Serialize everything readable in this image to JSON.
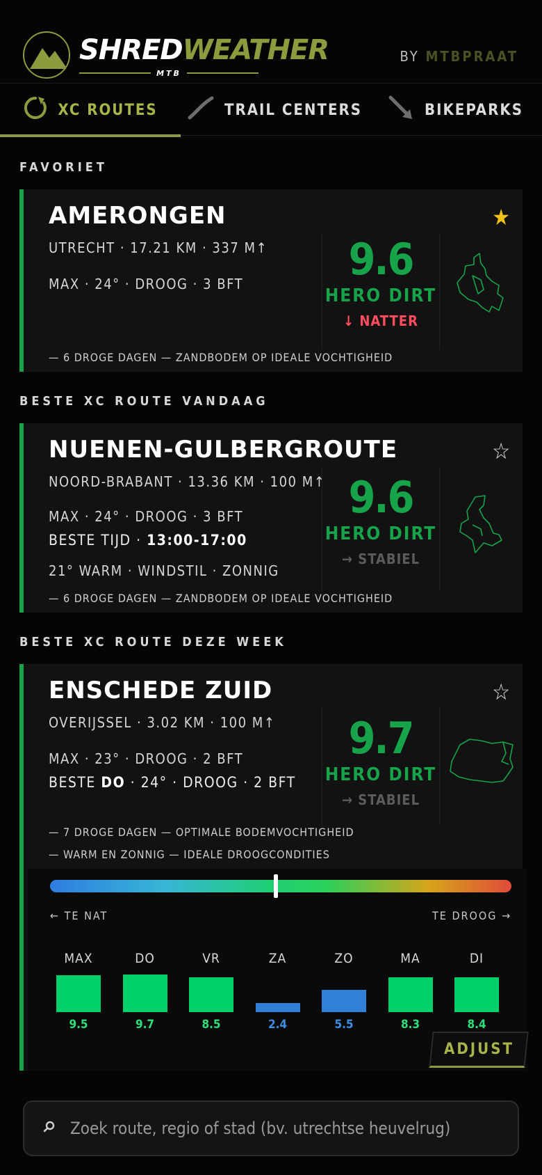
{
  "app": {
    "logo_part1": "SHRED",
    "logo_part2": "WEATHER",
    "logo_sub": "MTB",
    "by_label": "BY",
    "by_brand": "MTBPRAAT"
  },
  "tabs": [
    {
      "label": "XC ROUTES",
      "icon": "loop-icon",
      "active": true
    },
    {
      "label": "TRAIL CENTERS",
      "icon": "trail-icon",
      "active": false
    },
    {
      "label": "BIKEPARKS",
      "icon": "downhill-icon",
      "active": false
    }
  ],
  "sections": {
    "favorite": "FAVORIET",
    "best_today": "BESTE XC ROUTE VANDAAG",
    "best_week": "BESTE XC ROUTE DEZE WEEK"
  },
  "cards": {
    "amerongen": {
      "name": "AMERONGEN",
      "meta": "UTRECHT · 17.21 KM · 337 M↑",
      "weather": "MAX · 24° · DROOG · 3 BFT",
      "score": "9.6",
      "score_label": "HERO DIRT",
      "trend": "↓ NATTER",
      "notes": [
        "— 6 DROGE DAGEN — ZANDBODEM OP IDEALE VOCHTIGHEID"
      ],
      "favorite": true
    },
    "nuenen": {
      "name": "NUENEN-GULBERGROUTE",
      "meta": "NOORD-BRABANT · 13.36 KM · 100 M↑",
      "weather": "MAX · 24° · DROOG · 3 BFT",
      "best_time_label": "BESTE TIJD ·",
      "best_time_value": "13:00-17:00",
      "conditions": "21° WARM · WINDSTIL · ZONNIG",
      "score": "9.6",
      "score_label": "HERO DIRT",
      "trend": "→ STABIEL",
      "notes": [
        "— 6 DROGE DAGEN — ZANDBODEM OP IDEALE VOCHTIGHEID"
      ],
      "favorite": false
    },
    "enschede": {
      "name": "ENSCHEDE ZUID",
      "meta": "OVERIJSSEL · 3.02 KM · 100 M↑",
      "weather": "MAX · 23° · DROOG · 2 BFT",
      "best_prefix": "BESTE",
      "best_day": "DO",
      "best_suffix": "· 24° · DROOG · 2 BFT",
      "score": "9.7",
      "score_label": "HERO DIRT",
      "trend": "→ STABIEL",
      "notes": [
        "— 7 DROGE DAGEN — OPTIMALE BODEMVOCHTIGHEID",
        "— WARM EN ZONNIG — IDEALE DROOGCONDITIES"
      ],
      "favorite": false,
      "moisture_scale": {
        "left_label": "← TE NAT",
        "right_label": "TE DROOG →",
        "marker_position": 0.49
      },
      "forecast": [
        {
          "day": "MAX",
          "value": "9.5",
          "color": "#00d06a"
        },
        {
          "day": "DO",
          "value": "9.7",
          "color": "#00d06a"
        },
        {
          "day": "VR",
          "value": "8.5",
          "color": "#00d06a"
        },
        {
          "day": "ZA",
          "value": "2.4",
          "color": "#2f80d6"
        },
        {
          "day": "ZO",
          "value": "5.5",
          "color": "#2f80d6"
        },
        {
          "day": "MA",
          "value": "8.3",
          "color": "#00d06a"
        },
        {
          "day": "DI",
          "value": "8.4",
          "color": "#00d06a"
        }
      ],
      "adjust_label": "ADJUST"
    }
  },
  "search": {
    "placeholder": "Zoek route, regio of stad (bv. utrechtse heuvelrug)",
    "value": ""
  }
}
